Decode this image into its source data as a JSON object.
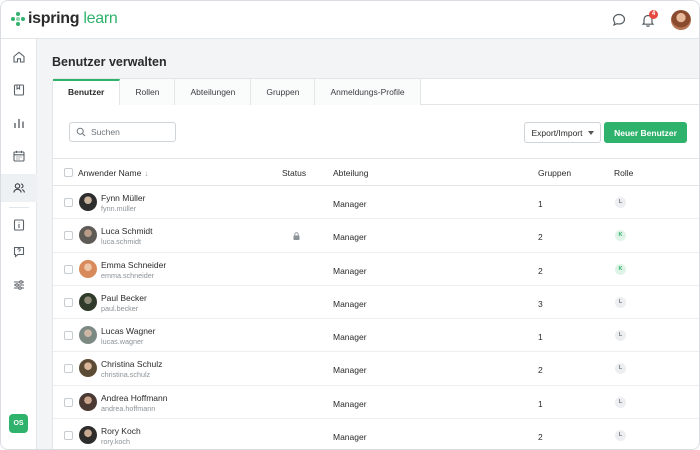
{
  "app": {
    "logo_text_main": "ispring",
    "logo_text_accent": "learn",
    "notification_count": "4",
    "user_initials": "OS"
  },
  "colors": {
    "accent": "#2eb26c",
    "badge_red": "#e8493f"
  },
  "sidebar": {
    "items": [
      {
        "icon": "home-icon"
      },
      {
        "icon": "courses-icon"
      },
      {
        "icon": "reports-icon"
      },
      {
        "icon": "calendar-icon"
      },
      {
        "icon": "users-icon",
        "active": true
      },
      {
        "icon": "info-icon"
      },
      {
        "icon": "help-icon"
      },
      {
        "icon": "settings-sliders-icon"
      }
    ]
  },
  "page": {
    "title": "Benutzer verwalten"
  },
  "tabs": [
    {
      "label": "Benutzer",
      "active": true
    },
    {
      "label": "Rollen"
    },
    {
      "label": "Abteilungen"
    },
    {
      "label": "Gruppen"
    },
    {
      "label": "Anmeldungs-Profile"
    }
  ],
  "toolbar": {
    "search_placeholder": "Suchen",
    "search_value": "",
    "export_label": "Export/Import",
    "new_user_label": "Neuer Benutzer"
  },
  "table": {
    "headers": {
      "name": "Anwender Name",
      "status": "Status",
      "department": "Abteilung",
      "groups": "Gruppen",
      "role": "Rolle"
    },
    "rows": [
      {
        "name": "Fynn Müller",
        "login": "fynn.müller",
        "locked": false,
        "department": "Manager",
        "groups": "1",
        "role": "L"
      },
      {
        "name": "Luca Schmidt",
        "login": "luca.schmidt",
        "locked": true,
        "department": "Manager",
        "groups": "2",
        "role": "K"
      },
      {
        "name": "Emma Schneider",
        "login": "emma.schneider",
        "locked": false,
        "department": "Manager",
        "groups": "2",
        "role": "K"
      },
      {
        "name": "Paul Becker",
        "login": "paul.becker",
        "locked": false,
        "department": "Manager",
        "groups": "3",
        "role": "L"
      },
      {
        "name": "Lucas Wagner",
        "login": "lucas.wagner",
        "locked": false,
        "department": "Manager",
        "groups": "1",
        "role": "L"
      },
      {
        "name": "Christina Schulz",
        "login": "christina.schulz",
        "locked": false,
        "department": "Manager",
        "groups": "2",
        "role": "L"
      },
      {
        "name": "Andrea Hoffmann",
        "login": "andrea.hoffmann",
        "locked": false,
        "department": "Manager",
        "groups": "1",
        "role": "L"
      },
      {
        "name": "Rory Koch",
        "login": "rory.koch",
        "locked": false,
        "department": "Manager",
        "groups": "2",
        "role": "L"
      }
    ]
  }
}
